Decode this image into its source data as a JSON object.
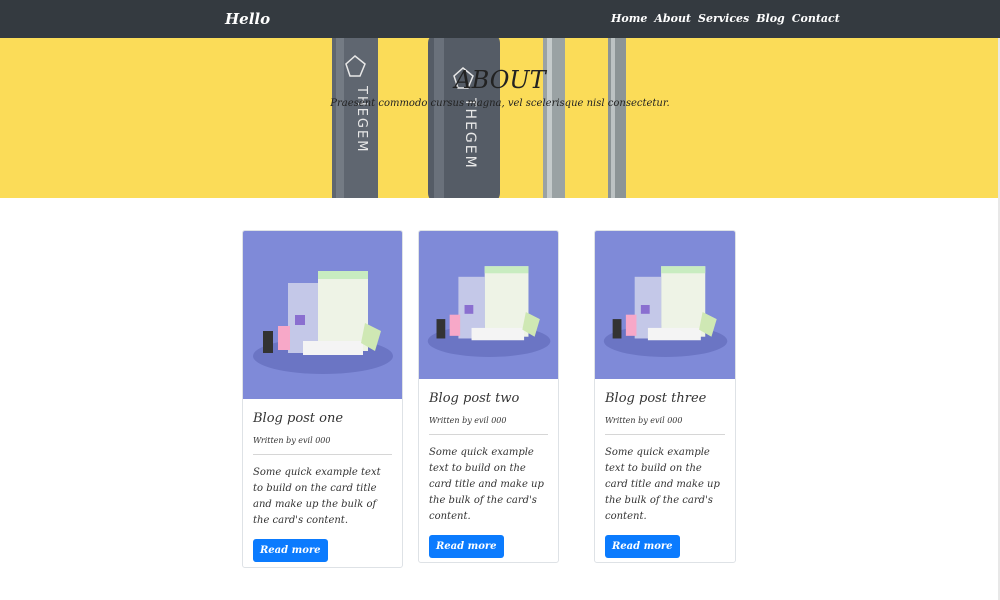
{
  "navbar": {
    "brand": "Hello",
    "links": [
      "Home",
      "About",
      "Services",
      "Blog",
      "Contact"
    ]
  },
  "hero": {
    "title": "ABOUT",
    "subtitle": "Praesent commodo cursus magna, vel scelerisque nisl consectetur.",
    "product_text": "THEGEM"
  },
  "cards": [
    {
      "title": "Blog post one",
      "author": "Written by evil 000",
      "text": "Some quick example text to build on the card title and make up the bulk of the card's content.",
      "button": "Read more"
    },
    {
      "title": "Blog post two",
      "author": "Written by evil 000",
      "text": "Some quick example text to build on the card title and make up the bulk of the card's content.",
      "button": "Read more"
    },
    {
      "title": "Blog post three",
      "author": "Written by evil 000",
      "text": "Some quick example text to build on the card title and make up the bulk of the card's content.",
      "button": "Read more"
    }
  ],
  "colors": {
    "navbar": "#343a40",
    "hero_bg": "#fbdc58",
    "button": "#0b7bfe",
    "card_image_bg": "#7f8ad8"
  }
}
